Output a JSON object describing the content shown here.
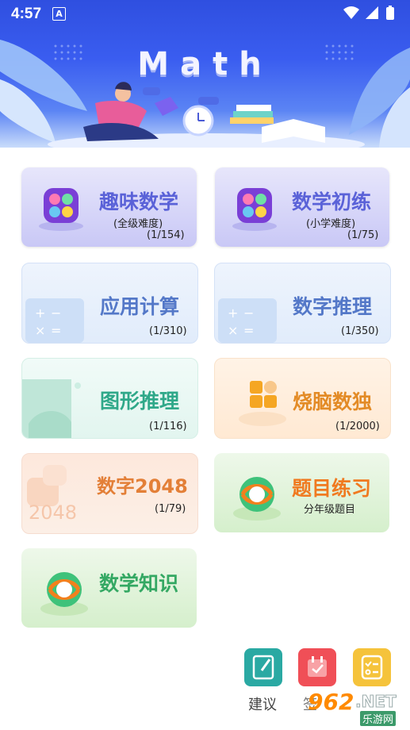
{
  "status_bar": {
    "time": "4:57",
    "notification_icon": "A"
  },
  "banner": {
    "title": "Math"
  },
  "cards": [
    {
      "title": "趣味数学",
      "subtitle": "(全级难度)",
      "count": "(1/154)"
    },
    {
      "title": "数学初练",
      "subtitle": "(小学难度)",
      "count": "(1/75)"
    },
    {
      "title": "应用计算",
      "count": "(1/310)"
    },
    {
      "title": "数字推理",
      "count": "(1/350)"
    },
    {
      "title": "图形推理",
      "count": "(1/116)"
    },
    {
      "title": "烧脑数独",
      "count": "(1/2000)"
    },
    {
      "title": "数字2048",
      "count": "(1/79)",
      "tile_text": "2048"
    },
    {
      "title": "题目练习",
      "subtitle": "分年级题目"
    },
    {
      "title": "数学知识"
    }
  ],
  "bottom": {
    "suggest_label": "建议",
    "partial_label": "签",
    "watermark_main": "962",
    "watermark_net": ".NET",
    "watermark_sub": "乐游网"
  }
}
